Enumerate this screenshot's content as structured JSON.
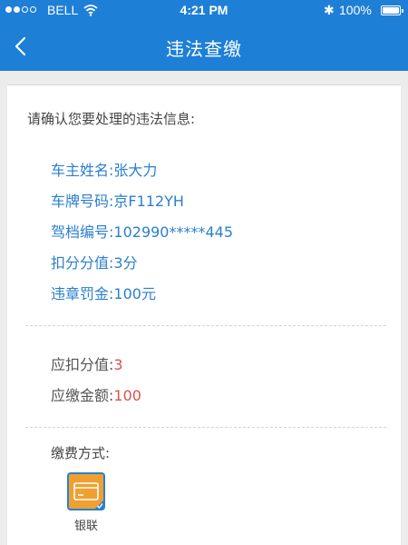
{
  "status_bar": {
    "carrier": "BELL",
    "time": "4:21 PM",
    "battery": "100%",
    "battery_level": 1.0,
    "bluetooth_glyph": "✱"
  },
  "nav": {
    "title": "违法查缴",
    "back_icon": "chevron-left-icon"
  },
  "content": {
    "prompt": "请确认您要处理的违法信息:",
    "violation_info": [
      {
        "label": "车主姓名:",
        "value": "张大力"
      },
      {
        "label": "车牌号码:",
        "value": "京F112YH"
      },
      {
        "label": "驾档编号:",
        "value": "102990*****445"
      },
      {
        "label": "扣分分值:",
        "value": "3分"
      },
      {
        "label": "违章罚金:",
        "value": "100元"
      }
    ],
    "amounts": [
      {
        "label": "应扣分值:",
        "value": "3"
      },
      {
        "label": "应缴金额:",
        "value": "100"
      }
    ],
    "payment": {
      "label": "缴费方式:",
      "options": [
        {
          "name": "银联",
          "icon": "bank-card-icon",
          "selected": true
        }
      ]
    }
  },
  "colors": {
    "primary": "#1e7fd6",
    "info_text": "#2a7fce",
    "amount_value": "#d9534f",
    "card_icon_bg": "#f0a030",
    "card_icon_border": "#2a7fce"
  }
}
